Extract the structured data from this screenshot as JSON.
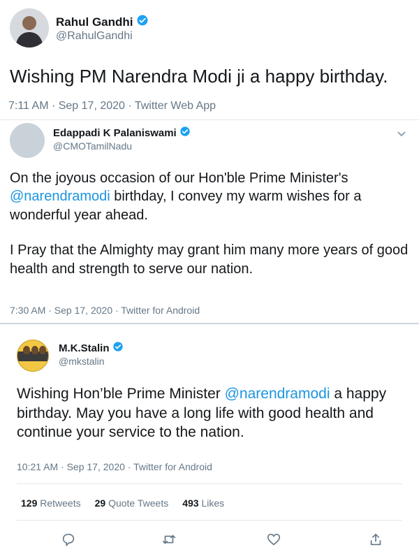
{
  "tweets": [
    {
      "name": "Rahul Gandhi",
      "handle": "@RahulGandhi",
      "text": "Wishing PM Narendra Modi ji a happy birthday.",
      "meta": "7:11 AM · Sep 17, 2020 · Twitter Web App"
    },
    {
      "name": "Edappadi K Palaniswami",
      "handle": "@CMOTamilNadu",
      "text_line1_pre": "On the joyous occasion of our Hon'ble Prime Minister's",
      "mention": "@narendramodi",
      "text_line2_post": " birthday, I convey my warm wishes for a wonderful year ahead.",
      "text_para2": "I Pray that the Almighty may grant him many more years of good health and strength to serve our nation.",
      "meta": "7:30 AM · Sep 17, 2020 · Twitter for Android"
    },
    {
      "name": "M.K.Stalin",
      "handle": "@mkstalin",
      "text_pre": "Wishing Hon’ble Prime Minister ",
      "mention": "@narendramodi",
      "text_post": " a happy birthday. May you have a long life with good health and continue your service to the nation.",
      "meta": "10:21 AM · Sep 17, 2020 · Twitter for Android",
      "retweets": "129",
      "retweets_label": "Retweets",
      "quotes": "29",
      "quotes_label": "Quote Tweets",
      "likes": "493",
      "likes_label": "Likes"
    }
  ],
  "icons": {
    "verified": "verified-badge-icon",
    "caret": "chevron-down-icon",
    "reply": "reply-icon",
    "retweet": "retweet-icon",
    "like": "heart-icon",
    "share": "share-icon"
  },
  "colors": {
    "accent": "#1b95e0",
    "verified": "#1da1f2",
    "muted": "#657786"
  }
}
